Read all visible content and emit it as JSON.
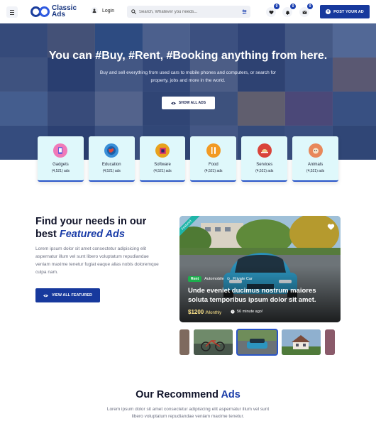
{
  "header": {
    "logo_line1": "Classic",
    "logo_line2": "Ads",
    "login_label": "Login",
    "search_placeholder": "Search, Whatever you needs...",
    "favorites_count": "0",
    "notifications_count": "0",
    "messages_count": "0",
    "post_ad_label": "POST YOUR AD"
  },
  "hero": {
    "title": "You can #Buy, #Rent, #Booking anything from here.",
    "subtitle": "Buy and sell everything from used cars to mobile phones and computers, or search for property, jobs and more in the world.",
    "show_all_label": "SHOW ALL ADS"
  },
  "categories": [
    {
      "name": "Gadgets",
      "count": "(4,521) ads",
      "icon": "gadgets-icon",
      "color": "#f07ab8"
    },
    {
      "name": "Education",
      "count": "(4,521) ads",
      "icon": "education-globe-icon",
      "color": "#3a8fd8"
    },
    {
      "name": "Software",
      "count": "(4,521) ads",
      "icon": "software-icon",
      "color": "#e8a21c"
    },
    {
      "name": "Food",
      "count": "(4,521) ads",
      "icon": "food-icon",
      "color": "#f29a23"
    },
    {
      "name": "Services",
      "count": "(4,521) ads",
      "icon": "services-icon",
      "color": "#d9433a"
    },
    {
      "name": "Animals",
      "count": "(4,521) ads",
      "icon": "animals-icon",
      "color": "#e8875a"
    }
  ],
  "featured": {
    "title_line1": "Find your needs in our",
    "title_prefix": "best ",
    "title_highlight": "Featured Ads",
    "text": "Lorem ipsum dolor sit amet consectetur adipisicing elit aspernatur illum vel sunt libero voluptatum repudiandae veniam maxime tenetur fugiat eaque alias nobis doloremque culpa nam.",
    "view_label": "VIEW ALL FEATURED",
    "card": {
      "ribbon": "Featured",
      "tag": "Rent",
      "category": "Automobile",
      "subcategory": "Private Car",
      "title": "Unde eveniet ducimus nostrum maiores soluta temporibus ipsum dolor sit amet.",
      "price": "$1200",
      "price_unit": "/Monthly",
      "time": "56 minute ago!"
    }
  },
  "recommend": {
    "title_prefix": "Our Recommend ",
    "title_highlight": "Ads",
    "text": "Lorem ipsum dolor sit amet consectetur adipisicing elit aspernatur illum vel sunt libero voluptatum repudiandae veniam maxime tenetur."
  }
}
